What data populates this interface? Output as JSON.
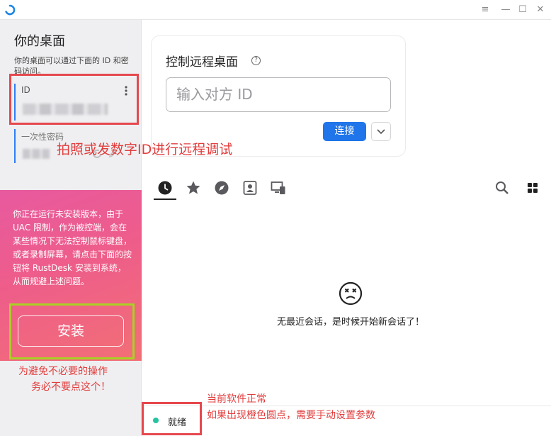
{
  "window": {
    "controls": [
      "menu",
      "minimize",
      "maximize",
      "close"
    ]
  },
  "sidebar": {
    "title": "你的桌面",
    "description": "你的桌面可以通过下面的 ID 和密码访问。",
    "id_label": "ID",
    "password_label": "一次性密码"
  },
  "warning": {
    "text": "你正在运行未安装版本，由于 UAC 限制，作为被控端，会在某些情况下无法控制鼠标键盘，或者录制屏幕，请点击下面的按钮将 RustDesk 安装到系统，从而规避上述问题。",
    "install_label": "安装"
  },
  "connect": {
    "title": "控制远程桌面",
    "id_placeholder": "输入对方 ID",
    "connect_label": "连接"
  },
  "tabs": [
    {
      "name": "recent",
      "icon": "clock-icon"
    },
    {
      "name": "favorites",
      "icon": "star-icon"
    },
    {
      "name": "discovered",
      "icon": "compass-icon"
    },
    {
      "name": "address-book",
      "icon": "contact-icon"
    },
    {
      "name": "group",
      "icon": "devices-icon"
    }
  ],
  "empty_state": {
    "text": "无最近会话，是时候开始新会话了！"
  },
  "status": {
    "text": "就绪",
    "color": "#26c3a0"
  },
  "annotations": {
    "id_note": "拍照或发数字ID进行远程调试",
    "install_note_line1": "为避免不必要的操作",
    "install_note_line2": "务必不要点这个！",
    "status_note_line1": "当前软件正常",
    "status_note_line2": "如果出现橙色圆点，需要手动设置参数"
  },
  "colors": {
    "accent": "#1f75e9",
    "annotation_red": "#e23d3d",
    "warning_gradient_start": "#e75a9f",
    "warning_gradient_end": "#f26f76",
    "status_ok": "#26c3a0"
  }
}
